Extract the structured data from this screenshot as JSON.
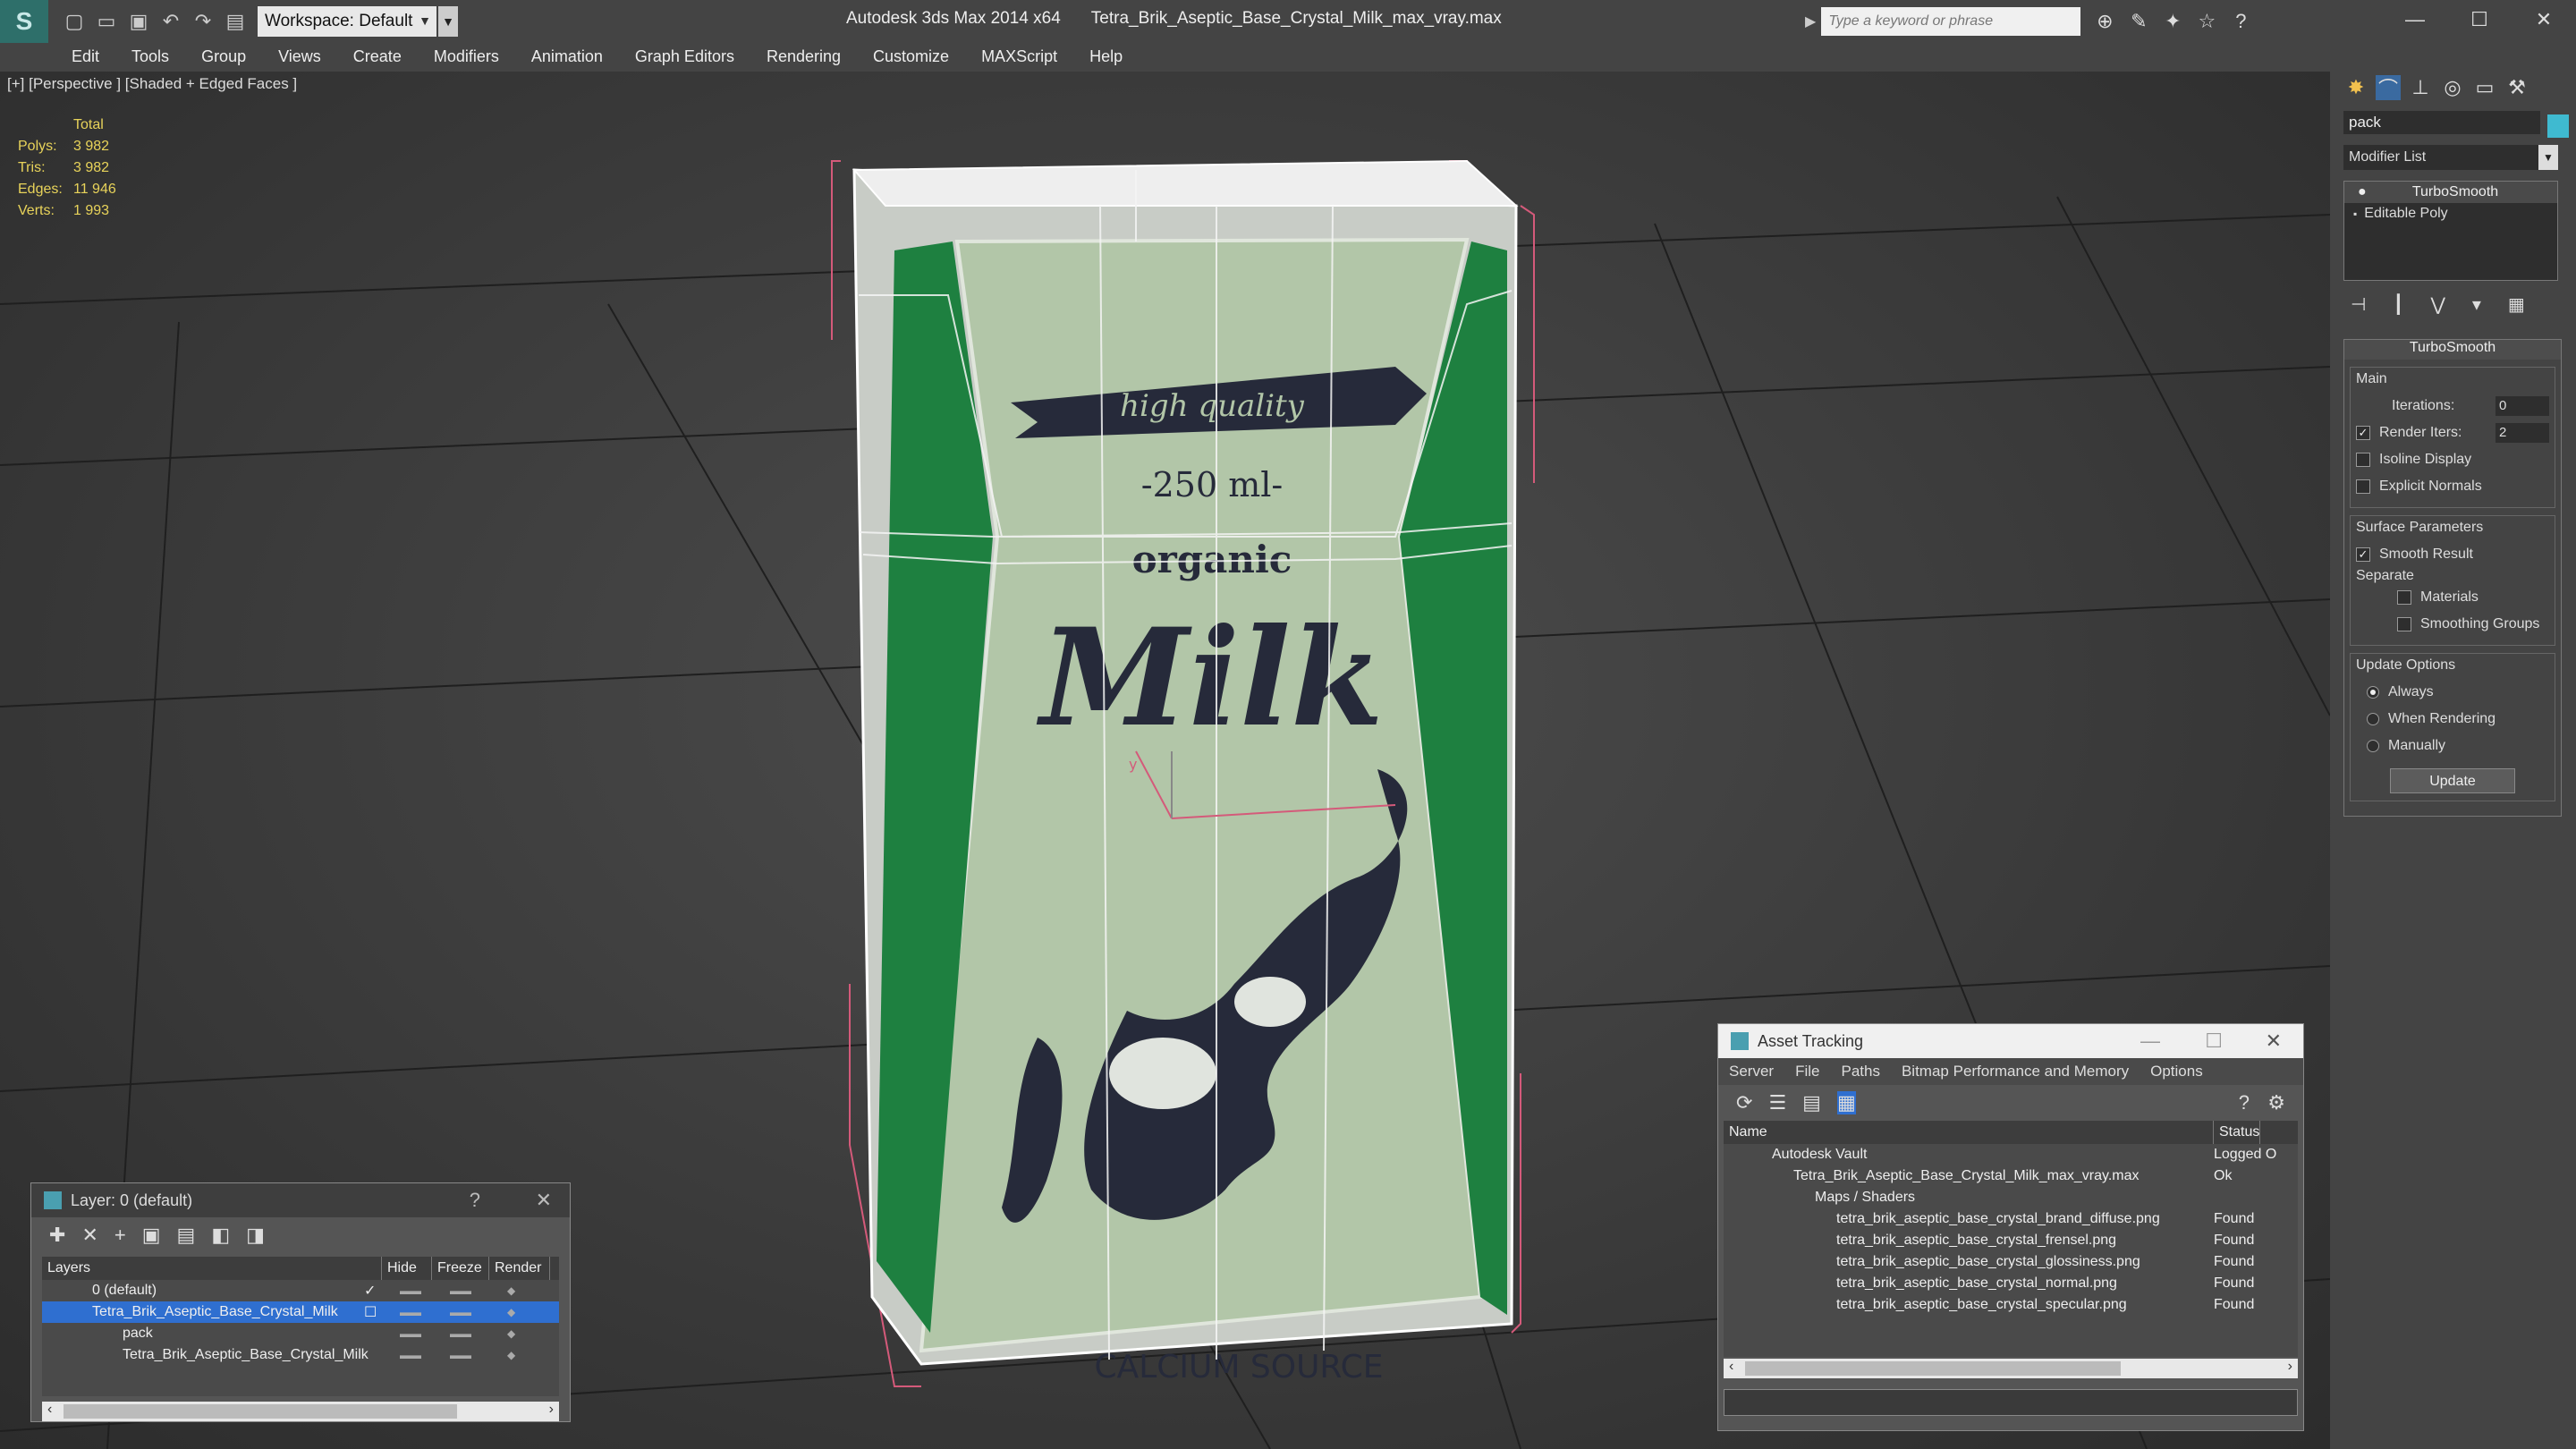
{
  "app": {
    "title": "Autodesk 3ds Max 2014 x64",
    "file": "Tetra_Brik_Aseptic_Base_Crystal_Milk_max_vray.max",
    "logo": "S",
    "workspace": "Workspace: Default",
    "search_placeholder": "Type a keyword or phrase"
  },
  "menu": [
    "Edit",
    "Tools",
    "Group",
    "Views",
    "Create",
    "Modifiers",
    "Animation",
    "Graph Editors",
    "Rendering",
    "Customize",
    "MAXScript",
    "Help"
  ],
  "viewport": {
    "label": "[+] [Perspective ] [Shaded + Edged Faces ]",
    "stats_header": "Total",
    "stats": [
      {
        "k": "Polys:",
        "v": "3 982"
      },
      {
        "k": "Tris:",
        "v": "3 982"
      },
      {
        "k": "Edges:",
        "v": "11 946"
      },
      {
        "k": "Verts:",
        "v": "1 993"
      }
    ]
  },
  "carton": {
    "ribbon": "high quality",
    "volume": "-250 ml-",
    "organic": "organic",
    "milk": "Milk",
    "calcium": "CALCIUM SOURCE",
    "axis_y": "y"
  },
  "colors": {
    "green": "#1e8040",
    "light": "#b2c6a8",
    "navy": "#262a3a",
    "pink": "#d45a7a",
    "stats": "#e8d35a",
    "select": "#2f6fd0"
  },
  "layer": {
    "title": "Layer: 0 (default)",
    "help": "?",
    "close": "✕",
    "cols": [
      "Layers",
      "Hide",
      "Freeze",
      "Render"
    ],
    "rows": [
      {
        "name": "0 (default)",
        "indent": 1
      },
      {
        "name": "Tetra_Brik_Aseptic_Base_Crystal_Milk",
        "indent": 1,
        "selected": true
      },
      {
        "name": "pack",
        "indent": 2
      },
      {
        "name": "Tetra_Brik_Aseptic_Base_Crystal_Milk",
        "indent": 2
      }
    ]
  },
  "asset": {
    "title": "Asset Tracking",
    "menu": [
      "Server",
      "File",
      "Paths",
      "Bitmap Performance and Memory",
      "Options"
    ],
    "cols": [
      "Name",
      "Status"
    ],
    "rows": [
      {
        "name": "Autodesk Vault",
        "status": "Logged O",
        "indent": 0
      },
      {
        "name": "Tetra_Brik_Aseptic_Base_Crystal_Milk_max_vray.max",
        "status": "Ok",
        "indent": 1
      },
      {
        "name": "Maps / Shaders",
        "status": "",
        "indent": 2
      },
      {
        "name": "tetra_brik_aseptic_base_crystal_brand_diffuse.png",
        "status": "Found",
        "indent": 3
      },
      {
        "name": "tetra_brik_aseptic_base_crystal_frensel.png",
        "status": "Found",
        "indent": 3
      },
      {
        "name": "tetra_brik_aseptic_base_crystal_glossiness.png",
        "status": "Found",
        "indent": 3
      },
      {
        "name": "tetra_brik_aseptic_base_crystal_normal.png",
        "status": "Found",
        "indent": 3
      },
      {
        "name": "tetra_brik_aseptic_base_crystal_specular.png",
        "status": "Found",
        "indent": 3
      }
    ]
  },
  "cmd": {
    "object": "pack",
    "modlist": "Modifier List",
    "stack": [
      "TurboSmooth",
      "Editable Poly"
    ],
    "rollout": "TurboSmooth",
    "main": "Main",
    "iterations_label": "Iterations:",
    "iterations": "0",
    "render_iters_label": "Render Iters:",
    "render_iters": "2",
    "isoline": "Isoline Display",
    "explicit": "Explicit Normals",
    "surface": "Surface Parameters",
    "smooth": "Smooth Result",
    "separate": "Separate",
    "materials": "Materials",
    "smoothing": "Smoothing Groups",
    "update_opts": "Update Options",
    "always": "Always",
    "when_rendering": "When Rendering",
    "manually": "Manually",
    "update": "Update"
  }
}
